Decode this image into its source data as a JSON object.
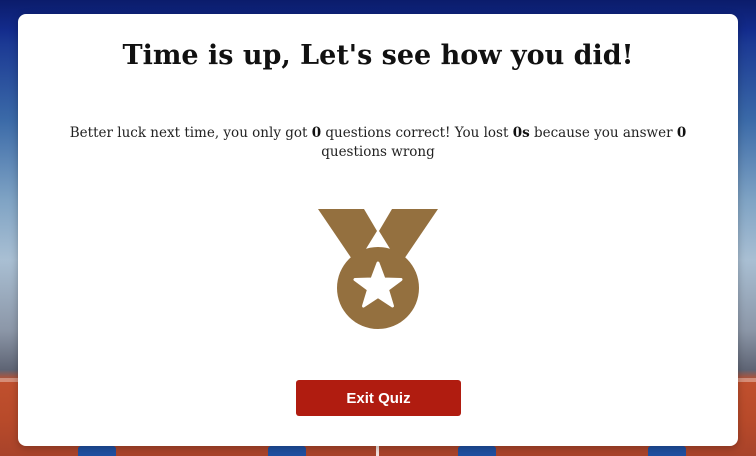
{
  "modal": {
    "title": "Time is up, Let's see how you did!",
    "message": {
      "part1": "Better luck next time, you only got ",
      "correct_count": "0",
      "part2": " questions correct! You lost ",
      "time_lost": "0s",
      "part3": " because you answer ",
      "wrong_count": "0",
      "part4": " questions wrong"
    },
    "medal_icon": "bronze-medal-star-icon",
    "exit_button_label": "Exit Quiz"
  },
  "colors": {
    "medal": "#94703f",
    "exit_button": "#b01c10",
    "modal_background": "#ffffff"
  }
}
